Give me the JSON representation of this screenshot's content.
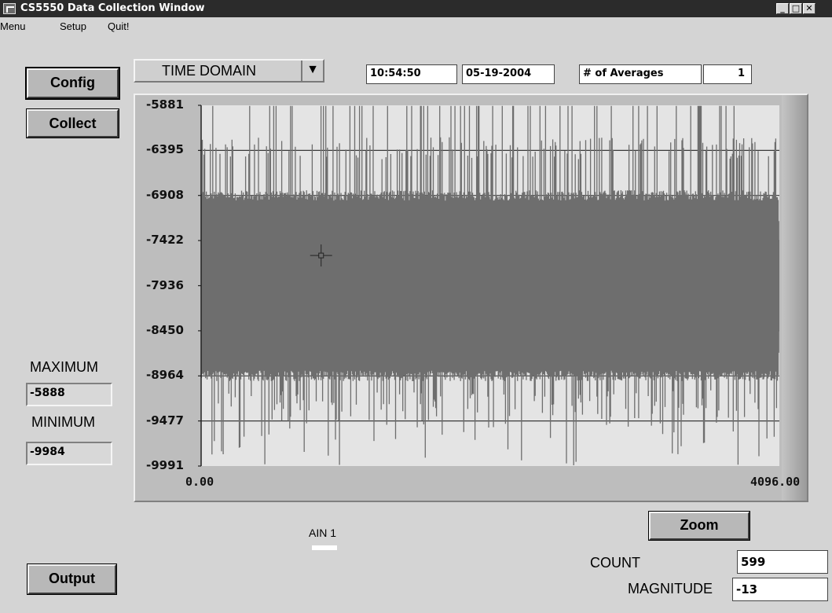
{
  "window": {
    "title": "CS5550 Data Collection Window",
    "controls": [
      "_",
      "□",
      "✕"
    ]
  },
  "menu": [
    "Menu",
    "Setup",
    "Quit!"
  ],
  "buttons": {
    "config": "Config",
    "collect": "Collect",
    "output": "Output",
    "zoom": "Zoom"
  },
  "mode_select": {
    "value": "TIME DOMAIN",
    "arrow": "▼"
  },
  "header": {
    "time": "10:54:50",
    "date": "05-19-2004",
    "averages_label": "# of Averages",
    "averages_value": "1"
  },
  "stats": {
    "maximum_label": "MAXIMUM",
    "maximum_value": "-5888",
    "minimum_label": "MINIMUM",
    "minimum_value": "-9984"
  },
  "channel": {
    "label": "AIN 1",
    "color": "#ffffff"
  },
  "readouts": {
    "count_label": "COUNT",
    "count_value": "599",
    "magnitude_label": "MAGNITUDE",
    "magnitude_value": "-13"
  },
  "chart_data": {
    "type": "line",
    "title": "",
    "xlabel": "",
    "ylabel": "",
    "xlim": [
      0,
      4096
    ],
    "ylim": [
      -9991,
      -5881
    ],
    "x_tick_labels": [
      "0.00",
      "4096.00"
    ],
    "y_ticks": [
      -5881,
      -6395,
      -6908,
      -7422,
      -7936,
      -8450,
      -8964,
      -9477,
      -9991
    ],
    "y_tick_labels": [
      "-5881",
      "-6395",
      "-6908",
      "-7422",
      "-7936",
      "-8450",
      "-8964",
      "-9477",
      "-9991"
    ],
    "grid": true,
    "series": [
      {
        "color": "#6e6e6e",
        "n_points": 4096,
        "dense_band": [
          -8450,
          -7422
        ],
        "common_range": [
          -8964,
          -6908
        ],
        "observed_max": -5888,
        "observed_min": -9984
      }
    ],
    "plot_background": "#e4e4e4",
    "cursor_marker": {
      "x": 850,
      "y": -7592
    }
  }
}
